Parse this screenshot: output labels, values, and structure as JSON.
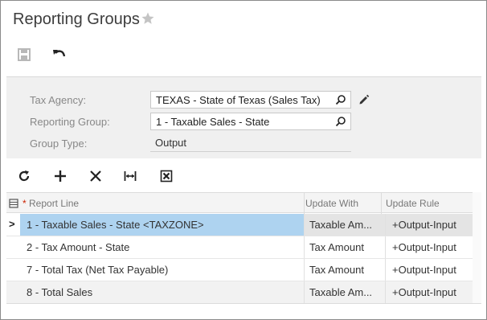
{
  "header": {
    "title": "Reporting Groups"
  },
  "toolbar": {
    "save_icon": "save-icon",
    "undo_icon": "undo-icon"
  },
  "form": {
    "tax_agency_label": "Tax Agency:",
    "tax_agency_value": "TEXAS - State of Texas (Sales Tax)",
    "reporting_group_label": "Reporting Group:",
    "reporting_group_value": "1 - Taxable Sales - State",
    "group_type_label": "Group Type:",
    "group_type_value": "Output"
  },
  "grid": {
    "columns": {
      "report_line": "Report Line",
      "required_mark": "*",
      "update_with": "Update With",
      "update_rule": "Update Rule"
    },
    "rows": [
      {
        "report_line": "1 - Taxable Sales - State <TAXZONE>",
        "update_with": "Taxable Am...",
        "update_rule": "+Output-Input"
      },
      {
        "report_line": "2 - Tax Amount - State",
        "update_with": "Tax Amount",
        "update_rule": "+Output-Input"
      },
      {
        "report_line": "7 - Total Tax (Net Tax Payable)",
        "update_with": "Tax Amount",
        "update_rule": "+Output-Input"
      },
      {
        "report_line": "8 - Total Sales",
        "update_with": "Taxable Am...",
        "update_rule": "+Output-Input"
      }
    ],
    "row_indicator": ">"
  },
  "colors": {
    "selected_row": "#aed3f0",
    "form_bg": "#f0f0f0",
    "accent_red": "#cc2200"
  }
}
